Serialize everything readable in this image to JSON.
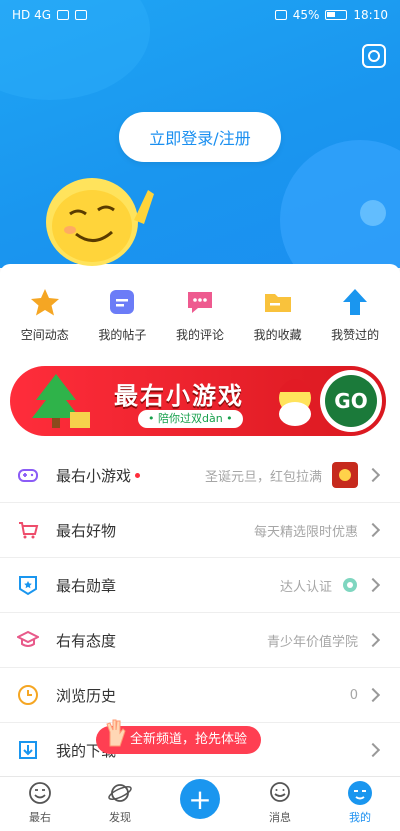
{
  "status_bar": {
    "left": "HD 4G",
    "battery": "45%",
    "time": "18:10"
  },
  "header": {
    "login_label": "立即登录/注册"
  },
  "quick_actions": [
    {
      "label": "空间动态",
      "icon": "star-icon",
      "color": "#f5a623"
    },
    {
      "label": "我的帖子",
      "icon": "document-icon",
      "color": "#6b7cf7"
    },
    {
      "label": "我的评论",
      "icon": "comment-icon",
      "color": "#ee5a8f"
    },
    {
      "label": "我的收藏",
      "icon": "folder-icon",
      "color": "#f9c23c"
    },
    {
      "label": "我赞过的",
      "icon": "upvote-icon",
      "color": "#1a96ef"
    }
  ],
  "banner": {
    "title": "最右小游戏",
    "subtitle": "• 陪你过双dàn •",
    "go": "GO"
  },
  "menu": [
    {
      "label": "最右小游戏",
      "value": "圣诞元旦，红包拉满",
      "dot": true,
      "thumb": true,
      "icon": "gamepad-icon",
      "color": "#8b5cf6"
    },
    {
      "label": "最右好物",
      "value": "每天精选限时优惠",
      "icon": "cart-icon",
      "color": "#ee4d6b"
    },
    {
      "label": "最右勋章",
      "value": "达人认证",
      "icon": "badge-icon",
      "color": "#1a96ef",
      "badge": true
    },
    {
      "label": "右有态度",
      "value": "青少年价值学院",
      "icon": "graduation-cap-icon",
      "color": "#e85a8a"
    },
    {
      "label": "浏览历史",
      "value": "0",
      "icon": "clock-icon",
      "color": "#f5a623"
    },
    {
      "label": "我的下载",
      "value": "",
      "icon": "download-icon",
      "color": "#1a96ef"
    }
  ],
  "toast": {
    "text": "全新频道，抢先体验"
  },
  "tabbar": [
    {
      "label": "最右",
      "icon": "smile-icon"
    },
    {
      "label": "发现",
      "icon": "planet-icon"
    },
    {
      "label": "",
      "icon": "plus-icon"
    },
    {
      "label": "消息",
      "icon": "message-icon"
    },
    {
      "label": "我的",
      "icon": "profile-icon",
      "active": true
    }
  ],
  "colors": {
    "primary": "#1a96ef",
    "accent": "#ff3f52"
  }
}
